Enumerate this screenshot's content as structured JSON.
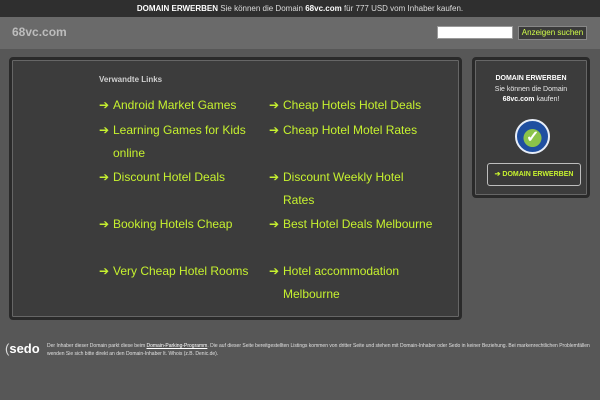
{
  "topbar": {
    "strong": "DOMAIN ERWERBEN",
    "text_1": "Sie können die Domain",
    "domain": "68vc.com",
    "text_2": "für 777 USD vom Inhaber kaufen."
  },
  "header": {
    "domain_title": "68vc.com",
    "search_value": "",
    "search_button": "Anzeigen suchen"
  },
  "main": {
    "heading": "Verwandte Links",
    "arrow_glyph": "➔",
    "links": [
      "Android Market Games",
      "Cheap Hotels Hotel Deals",
      "Learning Games for Kids online",
      "Cheap Hotel Motel Rates",
      "Discount Hotel Deals",
      "Discount Weekly Hotel Rates",
      "Booking Hotels Cheap",
      "Best Hotel Deals Melbourne",
      "Very Cheap Hotel Rooms",
      "Hotel accommodation Melbourne"
    ]
  },
  "side": {
    "title": "DOMAIN ERWERBEN",
    "line_1": "Sie können die Domain",
    "domain": "68vc.com",
    "line_2_suffix": "kaufen!",
    "button": "DOMAIN ERWERBEN",
    "button_arrow": "➔"
  },
  "footer": {
    "logo": "sedo",
    "text_1": "Der Inhaber dieser Domain parkt diese beim",
    "link": "Domain-Parking-Programm",
    "text_2": ". Die auf dieser Seite bereitgestellten Listings kommen von dritter Seite und stehen mit Domain-Inhaber oder Sedo in keiner Beziehung. Bei markenrechtlichen Problemfällen wenden Sie sich bitte direkt an den Domain-Inhaber lt. Whois (z.B. Denic.de)."
  },
  "colors": {
    "accent": "#c6f12f",
    "background": "#575757",
    "panel": "#3c3c3c"
  }
}
